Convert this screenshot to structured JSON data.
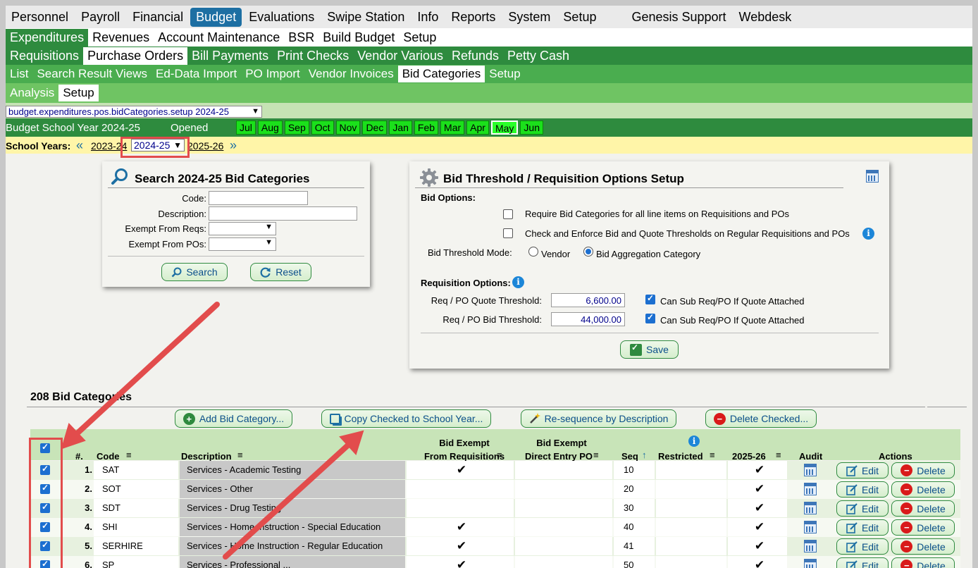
{
  "nav_main": [
    "Personnel",
    "Payroll",
    "Financial",
    "Budget",
    "Evaluations",
    "Swipe Station",
    "Info",
    "Reports",
    "System",
    "Setup"
  ],
  "nav_main_right": [
    "Genesis Support",
    "Webdesk"
  ],
  "nav_budget": [
    "Expenditures",
    "Revenues",
    "Account Maintenance",
    "BSR",
    "Build Budget",
    "Setup"
  ],
  "nav_exp": [
    "Requisitions",
    "Purchase Orders",
    "Bill Payments",
    "Print Checks",
    "Vendor Various",
    "Refunds",
    "Petty Cash"
  ],
  "nav_po": [
    "List",
    "Search Result Views",
    "Ed-Data Import",
    "PO Import",
    "Vendor Invoices",
    "Bid Categories",
    "Setup"
  ],
  "nav_bid": [
    "Analysis",
    "Setup"
  ],
  "path_select": "budget.expenditures.pos.bidCategories.setup 2024-25",
  "year_bar": {
    "label": "Budget School Year 2024-25",
    "status": "Opened",
    "months": [
      "Jul",
      "Aug",
      "Sep",
      "Oct",
      "Nov",
      "Dec",
      "Jan",
      "Feb",
      "Mar",
      "Apr",
      "May",
      "Jun"
    ]
  },
  "school_years": {
    "label": "School Years:",
    "prev": "2023-24",
    "current": "2024-25",
    "next": "2025-26"
  },
  "search_panel": {
    "title": "Search 2024-25 Bid Categories",
    "code_label": "Code:",
    "desc_label": "Description:",
    "exempt_reqs_label": "Exempt From Reqs:",
    "exempt_pos_label": "Exempt From POs:",
    "search_btn": "Search",
    "reset_btn": "Reset"
  },
  "threshold_panel": {
    "title": "Bid Threshold / Requisition Options Setup",
    "bid_options_label": "Bid Options:",
    "opt1": "Require Bid Categories for all line items on Requisitions and POs",
    "opt2": "Check and Enforce Bid and Quote Thresholds on Regular Requisitions and POs",
    "mode_label": "Bid Threshold Mode:",
    "mode_vendor": "Vendor",
    "mode_agg": "Bid Aggregation Category",
    "req_options_label": "Requisition Options:",
    "quote_label": "Req / PO Quote Threshold:",
    "quote_value": "6,600.00",
    "bid_label": "Req / PO Bid Threshold:",
    "bid_value": "44,000.00",
    "sub_label_1": "Can Sub Req/PO If Quote Attached",
    "sub_label_2": "Can Sub Req/PO If Quote Attached",
    "save_btn": "Save"
  },
  "list": {
    "count_title": "208 Bid Categories",
    "add_btn": "Add Bid Category...",
    "copy_btn": "Copy Checked to School Year...",
    "reseq_btn": "Re-sequence by Description",
    "delete_btn": "Delete Checked...",
    "headers": {
      "num": "#.",
      "code": "Code",
      "desc": "Description",
      "exempt_req_1": "Bid Exempt",
      "exempt_req_2": "From Requisitions",
      "exempt_po_1": "Bid Exempt",
      "exempt_po_2": "Direct Entry PO",
      "seq": "Seq",
      "restricted": "Restricted",
      "next_year": "2025-26",
      "audit": "Audit",
      "actions": "Actions"
    },
    "edit_label": "Edit",
    "delete_label": "Delete",
    "rows": [
      {
        "num": "1.",
        "code": "SAT",
        "desc": "Services - Academic Testing",
        "req": "✔",
        "po": "",
        "seq": "10",
        "next": "✔"
      },
      {
        "num": "2.",
        "code": "SOT",
        "desc": "Services - Other",
        "req": "",
        "po": "",
        "seq": "20",
        "next": "✔"
      },
      {
        "num": "3.",
        "code": "SDT",
        "desc": "Services - Drug Testing",
        "req": "",
        "po": "",
        "seq": "30",
        "next": "✔"
      },
      {
        "num": "4.",
        "code": "SHI",
        "desc": "Services - Home Instruction - Special Education",
        "req": "✔",
        "po": "",
        "seq": "40",
        "next": "✔"
      },
      {
        "num": "5.",
        "code": "SERHIRE",
        "desc": "Services - Home Instruction - Regular Education",
        "req": "✔",
        "po": "",
        "seq": "41",
        "next": "✔"
      },
      {
        "num": "6.",
        "code": "SP",
        "desc": "Services - Professional ...",
        "req": "✔",
        "po": "",
        "seq": "50",
        "next": "✔"
      }
    ]
  },
  "colors": {
    "accent": "#1d6fa3",
    "nav_green": "#2e8b3e",
    "annotation_red": "#e24c4c"
  }
}
